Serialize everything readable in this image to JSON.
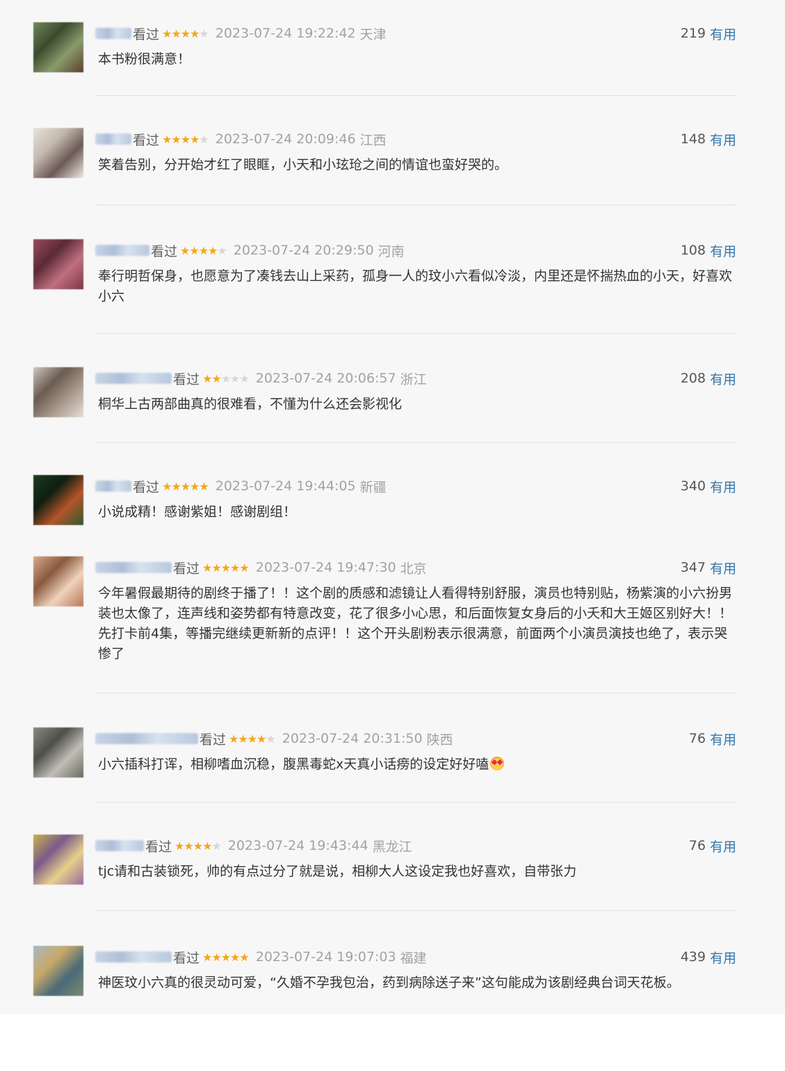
{
  "reviews": [
    {
      "watched": "看过",
      "rating": 4,
      "time": "2023-07-24 19:22:42",
      "location": "天津",
      "votes": "219",
      "useful_label": "有用",
      "comment": "本书粉很满意！",
      "emoji": ""
    },
    {
      "watched": "看过",
      "rating": 4,
      "time": "2023-07-24 20:09:46",
      "location": "江西",
      "votes": "148",
      "useful_label": "有用",
      "comment": "笑着告别，分开始才红了眼眶，小天和小玹玱之间的情谊也蛮好哭的。",
      "emoji": ""
    },
    {
      "watched": "看过",
      "rating": 4,
      "time": "2023-07-24 20:29:50",
      "location": "河南",
      "votes": "108",
      "useful_label": "有用",
      "comment": "奉行明哲保身，也愿意为了凑钱去山上采药，孤身一人的玟小六看似冷淡，内里还是怀揣热血的小天，好喜欢小六",
      "emoji": ""
    },
    {
      "watched": "看过",
      "rating": 2,
      "time": "2023-07-24 20:06:57",
      "location": "浙江",
      "votes": "208",
      "useful_label": "有用",
      "comment": "桐华上古两部曲真的很难看，不懂为什么还会影视化",
      "emoji": ""
    },
    {
      "watched": "看过",
      "rating": 5,
      "time": "2023-07-24 19:44:05",
      "location": "新疆",
      "votes": "340",
      "useful_label": "有用",
      "comment": "小说成精！感谢紫姐！感谢剧组！",
      "emoji": ""
    },
    {
      "watched": "看过",
      "rating": 5,
      "time": "2023-07-24 19:47:30",
      "location": "北京",
      "votes": "347",
      "useful_label": "有用",
      "comment": "今年暑假最期待的剧终于播了！！这个剧的质感和滤镜让人看得特别舒服，演员也特别贴，杨紫演的小六扮男装也太像了，连声线和姿势都有特意改变，花了很多小心思，和后面恢复女身后的小夭和大王姬区别好大！！先打卡前4集，等播完继续更新新的点评！！这个开头剧粉表示很满意，前面两个小演员演技也绝了，表示哭惨了",
      "emoji": ""
    },
    {
      "watched": "看过",
      "rating": 4,
      "time": "2023-07-24 20:31:50",
      "location": "陕西",
      "votes": "76",
      "useful_label": "有用",
      "comment": "小六插科打诨，相柳嗜血沉稳，腹黑毒蛇x天真小话痨的设定好好嗑",
      "emoji": "smiling-face-with-heart-eyes"
    },
    {
      "watched": "看过",
      "rating": 4,
      "time": "2023-07-24 19:43:44",
      "location": "黑龙江",
      "votes": "76",
      "useful_label": "有用",
      "comment": "tjc请和古装锁死，帅的有点过分了就是说，相柳大人这设定我也好喜欢，自带张力",
      "emoji": ""
    },
    {
      "watched": "看过",
      "rating": 5,
      "time": "2023-07-24 19:07:03",
      "location": "福建",
      "votes": "439",
      "useful_label": "有用",
      "comment": "神医玟小六真的很灵动可爱，“久婚不孕我包治，药到病除送子来”这句能成为该剧经典台词天花板。",
      "emoji": ""
    }
  ],
  "colors": {
    "star": "#f4a71c",
    "link": "#3377aa",
    "meta": "#a2a2a2",
    "text": "#333333"
  }
}
